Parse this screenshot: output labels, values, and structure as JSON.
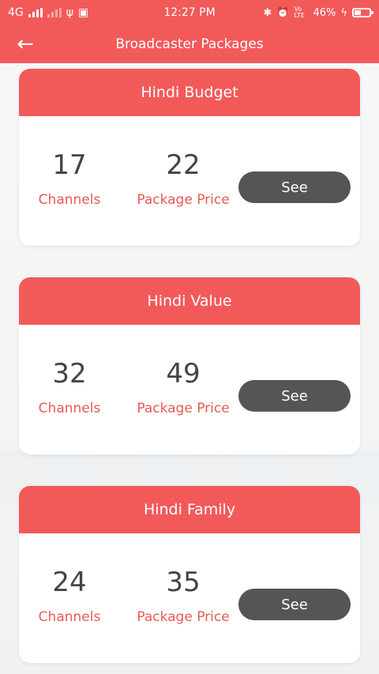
{
  "status_bar": {
    "network": "4G",
    "time": "12:27 PM",
    "volte": "Vo LTE",
    "battery": "46%",
    "battery_level": 0.46
  },
  "app_bar": {
    "title": "Broadcaster Packages"
  },
  "packages": [
    {
      "name": "Hindi Budget",
      "channels": "17",
      "channels_label": "Channels",
      "price": "22",
      "price_label": "Package Price",
      "button": "See"
    },
    {
      "name": "Hindi Value",
      "channels": "32",
      "channels_label": "Channels",
      "price": "49",
      "price_label": "Package Price",
      "button": "See"
    },
    {
      "name": "Hindi Family",
      "channels": "24",
      "channels_label": "Channels",
      "price": "35",
      "price_label": "Package Price",
      "button": "See"
    }
  ],
  "colors": {
    "accent": "#f25a5a",
    "label": "#e85a55",
    "button": "#555555"
  }
}
